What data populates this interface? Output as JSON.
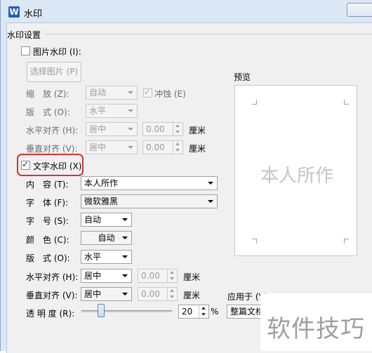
{
  "window": {
    "title": "水印",
    "logo": "W"
  },
  "group_label": "水印设置",
  "picture": {
    "checkbox_label": "图片水印 (I):",
    "checked": false,
    "select_button": "选择图片 (P)",
    "scale_label": "缩　放 (Z):",
    "scale_value": "自动",
    "washout_label": "冲蚀 (E)",
    "washout_checked": true,
    "layout_label": "版　式 (O):",
    "layout_value": "水平",
    "halign_label": "水平对齐 (H):",
    "halign_value": "居中",
    "halign_offset": "0.00",
    "halign_unit": "厘米",
    "valign_label": "垂直对齐 (V):",
    "valign_value": "居中",
    "valign_offset": "0.00",
    "valign_unit": "厘米"
  },
  "text": {
    "checkbox_label": "文字水印 (X)",
    "checked": true,
    "content_label": "内　容 (T):",
    "content_value": "本人所作",
    "font_label": "字　体 (F):",
    "font_value": "微软雅黑",
    "size_label": "字　号 (S):",
    "size_value": "自动",
    "color_label": "颜　色 (C):",
    "color_value": "自动",
    "layout_label": "版　式 (O):",
    "layout_value": "水平",
    "halign_label": "水平对齐 (H):",
    "halign_value": "居中",
    "halign_offset": "0.00",
    "halign_unit": "厘米",
    "valign_label": "垂直对齐 (V):",
    "valign_value": "居中",
    "valign_offset": "0.00",
    "valign_unit": "厘米",
    "transparency_label": "透 明 度 (R):",
    "transparency_value": "20",
    "transparency_unit": "%"
  },
  "preview": {
    "label": "预览",
    "watermark_text": "本人所作"
  },
  "apply_to": {
    "label": "应用于 (Y)",
    "value": "整篇文档"
  },
  "overlay_watermark": "软件技巧",
  "colors": {
    "highlight_border": "#d93232",
    "dialog_bg": "#f0f0f0",
    "title_bg": "#dce7f5"
  }
}
